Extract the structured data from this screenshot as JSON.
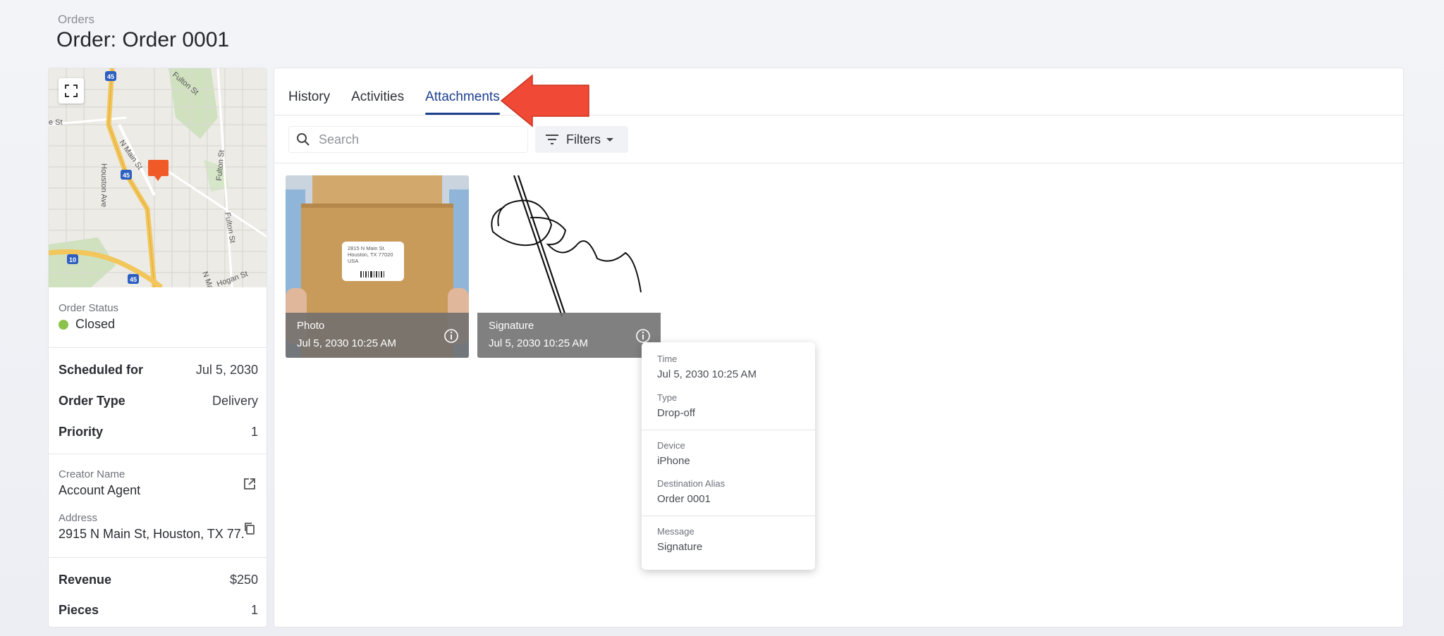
{
  "breadcrumb": "Orders",
  "page_title": "Order: Order 0001",
  "map": {
    "street_labels": [
      "Fulton St",
      "N Main St",
      "Houston Ave",
      "Fulton St",
      "Fulton St",
      "N Main",
      "Hogan St",
      "e St"
    ],
    "highway_shields": [
      "45",
      "45",
      "10",
      "45"
    ]
  },
  "order": {
    "status_label": "Order Status",
    "status_value": "Closed",
    "status_color": "#8bc34a",
    "scheduled_label": "Scheduled for",
    "scheduled_value": "Jul 5, 2030",
    "type_label": "Order Type",
    "type_value": "Delivery",
    "priority_label": "Priority",
    "priority_value": "1",
    "creator_label": "Creator Name",
    "creator_value": "Account Agent",
    "address_label": "Address",
    "address_value": "2915 N Main St, Houston, TX 77...",
    "revenue_label": "Revenue",
    "revenue_value": "$250",
    "pieces_label": "Pieces",
    "pieces_value": "1"
  },
  "tabs": [
    {
      "label": "History"
    },
    {
      "label": "Activities"
    },
    {
      "label": "Attachments",
      "active": true
    }
  ],
  "search": {
    "placeholder": "Search",
    "value": ""
  },
  "filters_label": "Filters",
  "attachments": [
    {
      "type": "Photo",
      "time": "Jul 5, 2030 10:25 AM",
      "box_label": [
        "2815 N Main St.",
        "Houston, TX 77020",
        "USA"
      ]
    },
    {
      "type": "Signature",
      "time": "Jul 5, 2030 10:25 AM"
    }
  ],
  "popover": {
    "time_label": "Time",
    "time_value": "Jul 5, 2030 10:25 AM",
    "type_label": "Type",
    "type_value": "Drop-off",
    "device_label": "Device",
    "device_value": "iPhone",
    "alias_label": "Destination Alias",
    "alias_value": "Order 0001",
    "message_label": "Message",
    "message_value": "Signature"
  },
  "colors": {
    "accent": "#1d3f8f",
    "arrow": "#f04a36",
    "map_marker": "#f05a28"
  }
}
